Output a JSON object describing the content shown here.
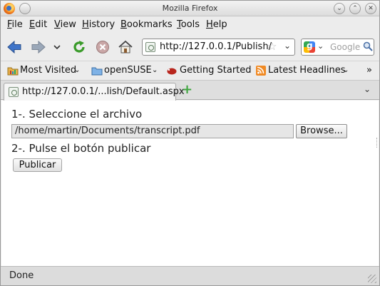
{
  "window": {
    "title": "Mozilla Firefox"
  },
  "menu": [
    "File",
    "Edit",
    "View",
    "History",
    "Bookmarks",
    "Tools",
    "Help"
  ],
  "navbar": {
    "url": "http://127.0.0.1/Publish/",
    "search_placeholder": "Google"
  },
  "bookmarks": {
    "items": [
      "Most Visited",
      "openSUSE",
      "Getting Started",
      "Latest Headlines"
    ],
    "overflow": "»"
  },
  "tabs": [
    {
      "label": "http://127.0.0.1/...lish/Default.aspx"
    }
  ],
  "content": {
    "step1": "1-. Seleccione el archivo",
    "file_value": "/home/martin/Documents/transcript.pdf",
    "browse_label": "Browse...",
    "step2": "2-. Pulse el botón publicar",
    "publish_label": "Publicar"
  },
  "status": {
    "text": "Done"
  }
}
